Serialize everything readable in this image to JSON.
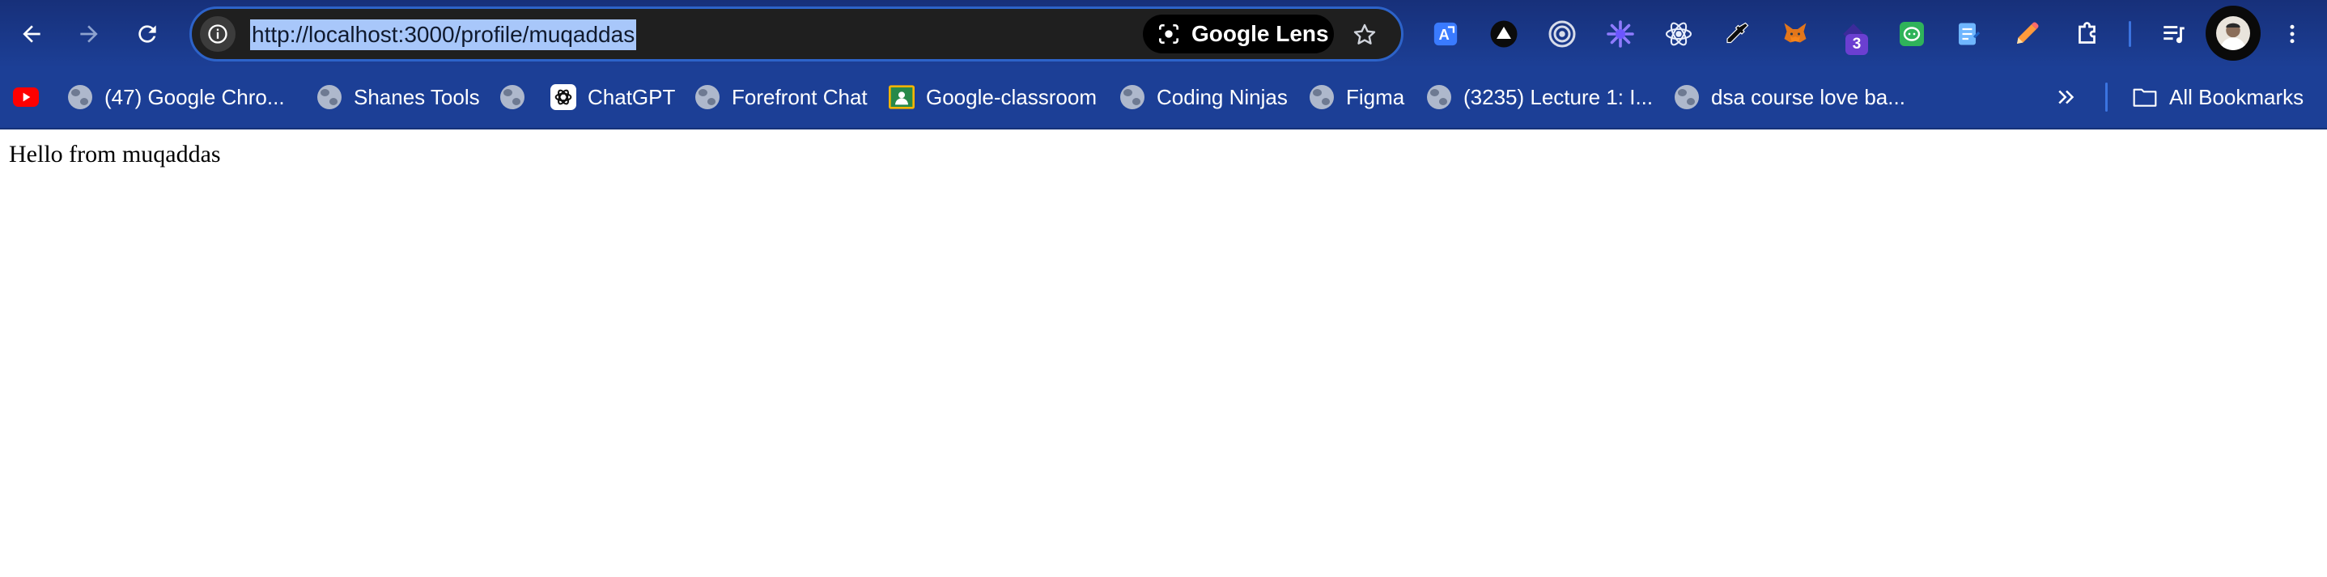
{
  "browser": {
    "address_bar": {
      "url": "http://localhost:3000/profile/muqaddas",
      "lens_label": "Google Lens"
    },
    "navigation": {
      "back": "arrow-left-icon",
      "forward": "arrow-right-icon",
      "reload": "reload-icon"
    },
    "extensions": [
      {
        "name": "translate-extension-icon"
      },
      {
        "name": "triangle-extension-icon"
      },
      {
        "name": "target-extension-icon"
      },
      {
        "name": "sparkle-extension-icon"
      },
      {
        "name": "react-devtools-icon"
      },
      {
        "name": "eyedropper-extension-icon"
      },
      {
        "name": "metamask-fox-icon"
      },
      {
        "name": "purple-extension-icon",
        "badge": "3"
      },
      {
        "name": "chat-extension-icon"
      },
      {
        "name": "notes-extension-icon"
      },
      {
        "name": "pencil-extension-icon"
      },
      {
        "name": "puzzle-extensions-icon"
      }
    ],
    "bookmarks": [
      {
        "label": "",
        "icon": "youtube-icon"
      },
      {
        "label": "(47) Google Chro...",
        "icon": "globe-icon"
      },
      {
        "label": "Shanes Tools",
        "icon": "globe-icon"
      },
      {
        "label": "",
        "icon": "globe-icon"
      },
      {
        "label": "ChatGPT",
        "icon": "chatgpt-icon"
      },
      {
        "label": "Forefront Chat",
        "icon": "globe-icon"
      },
      {
        "label": "Google-classroom",
        "icon": "classroom-icon"
      },
      {
        "label": "Coding Ninjas",
        "icon": "globe-icon"
      },
      {
        "label": "Figma",
        "icon": "globe-icon"
      },
      {
        "label": "(3235) Lecture 1: I...",
        "icon": "globe-icon"
      },
      {
        "label": "dsa course love ba...",
        "icon": "globe-icon"
      }
    ],
    "all_bookmarks_label": "All Bookmarks"
  },
  "page": {
    "text": "Hello from muqaddas"
  },
  "colors": {
    "toolbar": "#1c3f96",
    "omnibox": "#1f1f1f",
    "url_selection": "#a8c7fa",
    "accent": "#2d63c9"
  }
}
